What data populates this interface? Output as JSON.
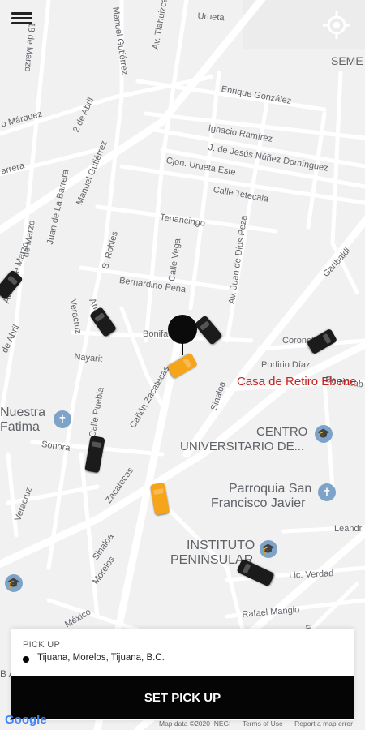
{
  "streets": [
    {
      "id": "urueta",
      "text": "Urueta"
    },
    {
      "id": "av-tlahuizcalpan",
      "text": "Av. Tlahuizcalpan"
    },
    {
      "id": "manuel-gutierrez-top",
      "text": "Manuel Gutiérrez"
    },
    {
      "id": "18-de-marzo-top",
      "text": "18 de Marzo"
    },
    {
      "id": "enrique-gonzalez",
      "text": "Enrique González"
    },
    {
      "id": "marquez",
      "text": "o Márquez"
    },
    {
      "id": "2-de-abril",
      "text": "2 de Abril"
    },
    {
      "id": "ignacio-ramirez",
      "text": "Ignacio Ramírez"
    },
    {
      "id": "jesus-nunez",
      "text": "J. de Jesús Núñez Domínguez"
    },
    {
      "id": "cjon-urueta-este",
      "text": "Cjon. Urueta Este"
    },
    {
      "id": "calle-tetecala",
      "text": "Calle Tetecala"
    },
    {
      "id": "barrera",
      "text": "arrera"
    },
    {
      "id": "manuel-gutierrez-mid",
      "text": "Manuel Gutiérrez"
    },
    {
      "id": "juan-de-la-barrera",
      "text": "Juan de La Barrera"
    },
    {
      "id": "tenancingo",
      "text": "Tenancingo"
    },
    {
      "id": "18-de-marzo-mid",
      "text": "de Marzo"
    },
    {
      "id": "s-robles",
      "text": "S. Robles"
    },
    {
      "id": "calle-vega",
      "text": "Calle Vega"
    },
    {
      "id": "av-juan-de-dios-peza",
      "text": "Av. Juan de Dios Peza"
    },
    {
      "id": "garibaldi",
      "text": "Garibaldi"
    },
    {
      "id": "av-18-de-marzo",
      "text": "Av. 18 de Marzo"
    },
    {
      "id": "bernardino-pena",
      "text": "Bernardino Pena"
    },
    {
      "id": "bonifacio",
      "text": "Bonifacio"
    },
    {
      "id": "anahuac",
      "text": "Anáhuac"
    },
    {
      "id": "de-abril",
      "text": "de Abril"
    },
    {
      "id": "veracruz-top",
      "text": "Veracruz"
    },
    {
      "id": "nayarit",
      "text": "Nayarit"
    },
    {
      "id": "coronel",
      "text": "Coronel"
    },
    {
      "id": "porfirio-diaz",
      "text": "Porfirio Díaz"
    },
    {
      "id": "canon-zacatecas",
      "text": "Cañón Zacatecas"
    },
    {
      "id": "sinaloa-mid",
      "text": "Sinaloa"
    },
    {
      "id": "berriozabal",
      "text": "Berriozab"
    },
    {
      "id": "calle-puebla",
      "text": "Calle Puebla"
    },
    {
      "id": "sonora",
      "text": "Sonora"
    },
    {
      "id": "zacatecas",
      "text": "Zacatecas"
    },
    {
      "id": "veracruz-low",
      "text": "Veracruz"
    },
    {
      "id": "sinaloa-low",
      "text": "Sinaloa"
    },
    {
      "id": "morelos",
      "text": "Morelos"
    },
    {
      "id": "leandro",
      "text": "Leandr"
    },
    {
      "id": "lic-verdad",
      "text": "Lic. Verdad"
    },
    {
      "id": "rafael-mangio",
      "text": "Rafael Mangio"
    },
    {
      "id": "mexico",
      "text": "México"
    },
    {
      "id": "e-label",
      "text": "E"
    }
  ],
  "pois": {
    "seme": "SEME",
    "casa_de_retiro": "Casa de Retiro Ebene",
    "nuestra_fatima_1": "Nuestra",
    "nuestra_fatima_2": "Fatima",
    "centro_1": "CENTRO",
    "centro_2": "UNIVERSITARIO DE...",
    "parroquia_1": "Parroquia San",
    "parroquia_2": "Francisco Javier",
    "instituto_1": "INSTITUTO",
    "instituto_2": "PENINSULAR",
    "b_a": "B A"
  },
  "panel": {
    "pickup_label": "PICK UP",
    "pickup_value": "Tijuana, Morelos, Tijuana, B.C.",
    "button_label": "SET PICK UP"
  },
  "attribution": {
    "google": "Google",
    "map_data": "Map data ©2020 INEGI",
    "terms": "Terms of Use",
    "report": "Report a map error"
  },
  "colors": {
    "accent": "#000000",
    "taxi": "#f6a51b",
    "map_background": "#f1f1f1",
    "road": "#ffffff"
  },
  "icons": {
    "menu": "hamburger-icon",
    "locate": "my-location-icon"
  }
}
